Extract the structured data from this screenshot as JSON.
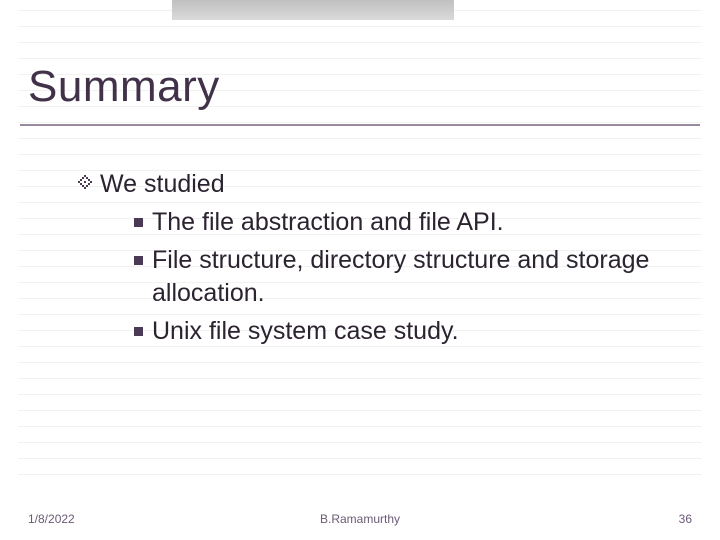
{
  "title": "Summary",
  "content": {
    "main_item": "We studied",
    "sub_items": [
      "The file abstraction and file API.",
      "File structure, directory structure and storage allocation.",
      "Unix file system case study."
    ]
  },
  "footer": {
    "date": "1/8/2022",
    "author": "B.Ramamurthy",
    "page": "36"
  },
  "colors": {
    "title": "#41324a",
    "underline": "#9a8aa0",
    "body": "#2b2330",
    "footer": "#6b5a76"
  }
}
